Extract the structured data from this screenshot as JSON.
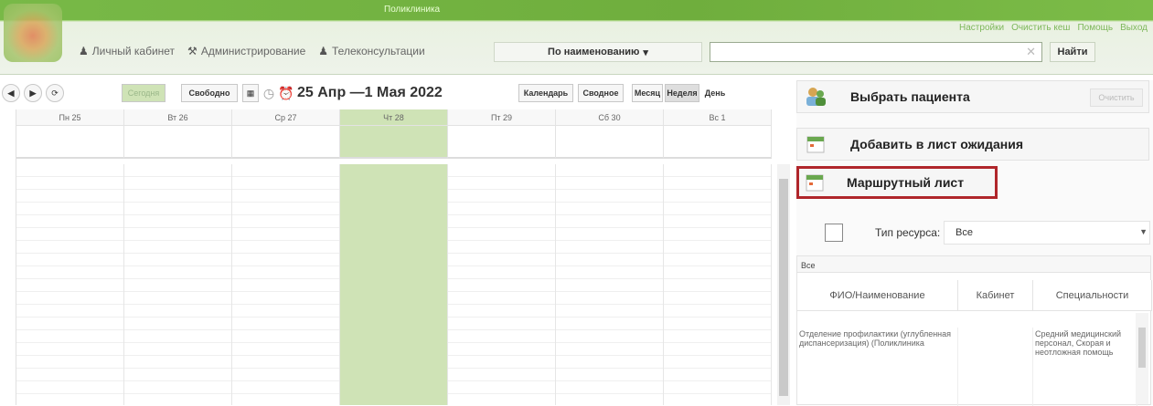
{
  "header": {
    "app_title": "Поликлиника",
    "links": [
      "Настройки",
      "Очистить кеш",
      "Помощь",
      "Выход"
    ],
    "menu": [
      {
        "icon": "user-icon",
        "label": "Личный кабинет"
      },
      {
        "icon": "tools-icon",
        "label": "Администрирование"
      },
      {
        "icon": "user-icon",
        "label": "Телеконсультации"
      }
    ],
    "search_mode": "По наименованию",
    "search_value": "",
    "search_button": "Найти"
  },
  "calendar": {
    "buttons": {
      "today": "Сегодня",
      "free": "Свободно"
    },
    "date_range": "25 Апр —1 Мая 2022",
    "views": [
      "Календарь",
      "Сводное",
      "Месяц",
      "Неделя",
      "День"
    ],
    "active_view": "Неделя",
    "days": [
      "Пн 25",
      "Вт 26",
      "Ср 27",
      "Чт 28",
      "Пт 29",
      "Сб 30",
      "Вс 1"
    ],
    "today_index": 3
  },
  "panel": {
    "select_patient": "Выбрать пациента",
    "clear_button": "Очистить",
    "add_waitlist": "Добавить в лист ожидания",
    "route_sheet": "Маршрутный лист",
    "resource_type_label": "Тип ресурса:",
    "resource_type_value": "Все",
    "table_title": "Все",
    "table_columns": [
      "ФИО/Наименование",
      "Кабинет",
      "Специальности"
    ],
    "table_rows": [
      {
        "name": "Отделение профилактики (углубленная диспансеризация) (Поликлиника",
        "cabinet": "",
        "specialty": "Средний медицинский персонал, Скорая и неотложная помощь"
      }
    ]
  },
  "colors": {
    "accent_green": "#7fbf4c",
    "highlight_red": "#b0262b",
    "today_col": "#cfe3b6"
  }
}
